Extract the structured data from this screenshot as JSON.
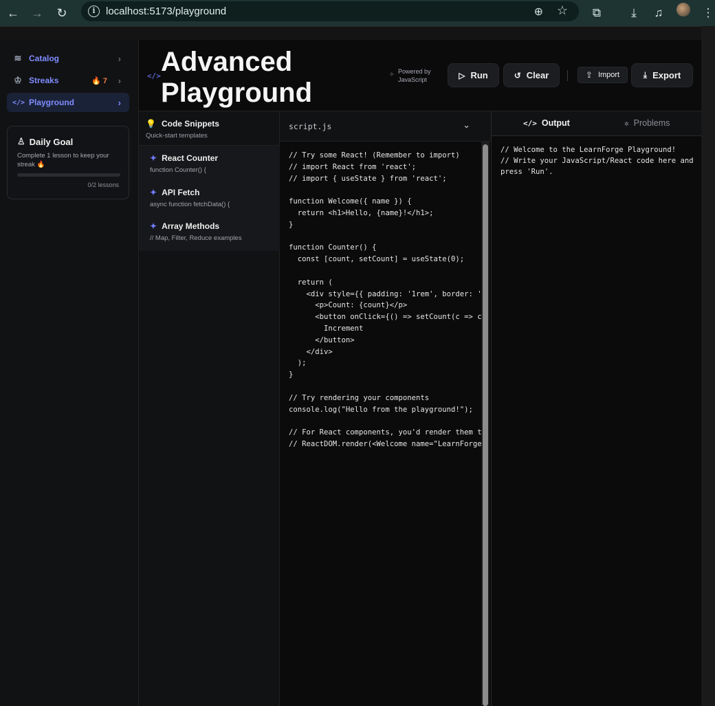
{
  "browser": {
    "url": "localhost:5173/playground",
    "icons": [
      "back-arrow-icon",
      "forward-arrow-icon",
      "reload-icon",
      "site-info-icon",
      "zoom-icon",
      "bookmark-star-icon",
      "extensions-icon",
      "downloads-icon",
      "media-icon",
      "profile-avatar",
      "menu-kebab-icon"
    ]
  },
  "sidebar": {
    "items": [
      {
        "label": "Catalog",
        "icon": "layers-icon"
      },
      {
        "label": "Streaks",
        "icon": "trophy-icon",
        "badge": "7"
      },
      {
        "label": "Playground",
        "icon": "code-icon"
      }
    ],
    "goal": {
      "title": "Daily Goal",
      "description": "Complete 1 lesson to keep your streak 🔥",
      "progress": 0,
      "count": "0/2 lessons"
    }
  },
  "header": {
    "title_line1": "Advanced",
    "title_line2": "Playground",
    "powered_line1": "Powered by",
    "powered_line2": "JavaScript",
    "run_label": "Run",
    "clear_label": "Clear",
    "import_label": "Import",
    "export_label": "Export"
  },
  "snippets": {
    "title": "Code Snippets",
    "subtitle": "Quick-start templates",
    "items": [
      {
        "title": "React Counter",
        "preview": "function Counter() {"
      },
      {
        "title": "API Fetch",
        "preview": "async function fetchData() {"
      },
      {
        "title": "Array Methods",
        "preview": "// Map, Filter, Reduce examples"
      }
    ]
  },
  "editor": {
    "filename": "script.js",
    "code": "// Try some React! (Remember to import)\n// import React from 'react';\n// import { useState } from 'react';\n\nfunction Welcome({ name }) {\n  return <h1>Hello, {name}!</h1>;\n}\n\nfunction Counter() {\n  const [count, setCount] = useState(0);\n\n  return (\n    <div style={{ padding: '1rem', border: '1p\n      <p>Count: {count}</p>\n      <button onClick={() => setCount(c => c \n        Increment\n      </button>\n    </div>\n  );\n}\n\n// Try rendering your components\nconsole.log(\"Hello from the playground!\");\n\n// For React components, you'd render them to\n// ReactDOM.render(<Welcome name=\"LearnForge\""
  },
  "output": {
    "tab_output": "Output",
    "tab_problems": "Problems",
    "text": "// Welcome to the LearnForge Playground!\n// Write your JavaScript/React code here and press 'Run'."
  },
  "colors": {
    "accent": "#7f8dff",
    "streak": "#f07a3a",
    "background": "#0b0b0c"
  }
}
